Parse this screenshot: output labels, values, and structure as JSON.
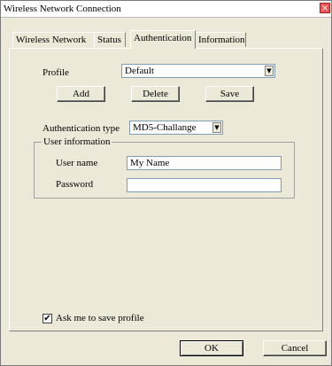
{
  "window": {
    "title": "Wireless Network Connection"
  },
  "tabs": [
    {
      "label": "Wireless Network"
    },
    {
      "label": "Status"
    },
    {
      "label": "Authentication"
    },
    {
      "label": "Information"
    }
  ],
  "profile": {
    "label": "Profile",
    "value": "Default",
    "add_label": "Add",
    "delete_label": "Delete",
    "save_label": "Save"
  },
  "auth": {
    "label": "Authentication type",
    "value": "MD5-Challange"
  },
  "user_info": {
    "group_title": "User information",
    "username_label": "User name",
    "username_value": "My Name",
    "password_label": "Password",
    "password_value": ""
  },
  "ask_save": {
    "label": "Ask me to save profile",
    "checked": "✔"
  },
  "footer": {
    "ok_label": "OK",
    "cancel_label": "Cancel"
  }
}
